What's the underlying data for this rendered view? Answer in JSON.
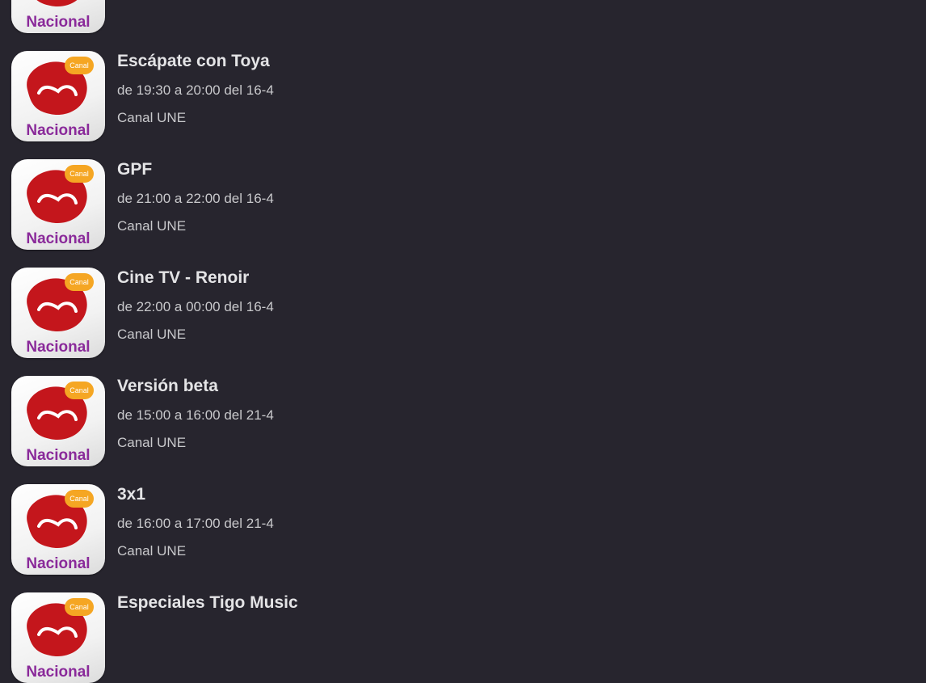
{
  "logo": {
    "brand_text": "une",
    "badge_text": "Canal",
    "footer_text": "Nacional",
    "icon": "canal-une-nacional-logo"
  },
  "programs": [
    {
      "title": "",
      "time": "",
      "channel": ""
    },
    {
      "title": "Escápate con Toya",
      "time": "de 19:30 a 20:00 del 16-4",
      "channel": "Canal UNE"
    },
    {
      "title": "GPF",
      "time": "de 21:00 a 22:00 del 16-4",
      "channel": "Canal UNE"
    },
    {
      "title": "Cine TV - Renoir",
      "time": "de 22:00 a 00:00 del 16-4",
      "channel": "Canal UNE"
    },
    {
      "title": "Versión beta",
      "time": "de 15:00 a 16:00 del 21-4",
      "channel": "Canal UNE"
    },
    {
      "title": "3x1",
      "time": "de 16:00 a 17:00 del 21-4",
      "channel": "Canal UNE"
    },
    {
      "title": "Especiales Tigo Music",
      "time": "",
      "channel": ""
    }
  ],
  "colors": {
    "background": "#27252e",
    "logo_red": "#c4161c",
    "logo_orange": "#f5a623",
    "logo_purple": "#8a2a9a"
  }
}
